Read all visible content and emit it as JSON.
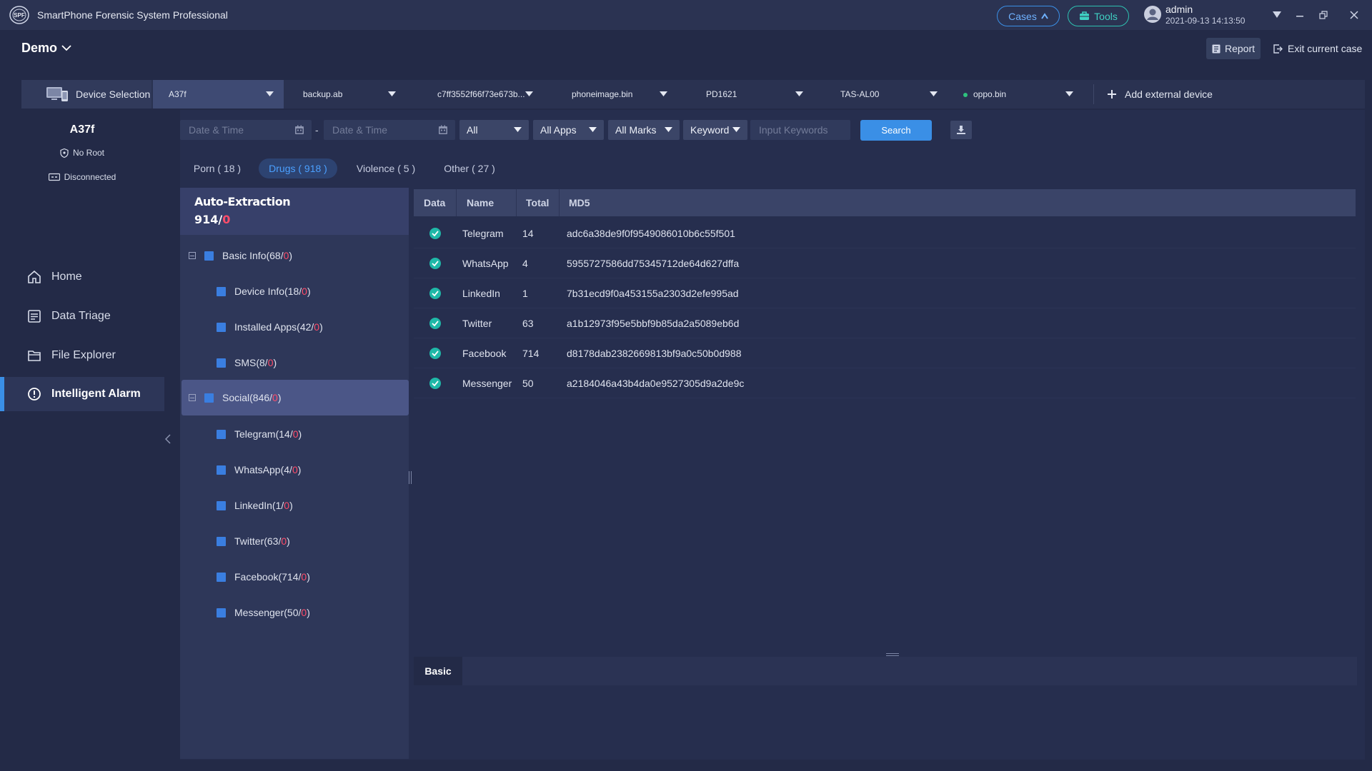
{
  "app": {
    "title": "SmartPhone Forensic System Professional",
    "logo_text": "SPF"
  },
  "header": {
    "cases_label": "Cases",
    "tools_label": "Tools",
    "user_name": "admin",
    "user_time": "2021-09-13 14:13:50"
  },
  "case": {
    "name": "Demo",
    "report_label": "Report",
    "exit_label": "Exit current case"
  },
  "devices": {
    "selection_label": "Device Selection",
    "tabs": [
      {
        "label": "A37f"
      },
      {
        "label": "backup.ab"
      },
      {
        "label": "c7ff3552f66f73e673b..."
      },
      {
        "label": "phoneimage.bin"
      },
      {
        "label": "PD1621"
      },
      {
        "label": "TAS-AL00"
      },
      {
        "label": "oppo.bin"
      }
    ],
    "add_external_label": "Add external device"
  },
  "sidebar": {
    "device_name": "A37f",
    "root_status": "No Root",
    "connection_status": "Disconnected",
    "nav": [
      {
        "label": "Home"
      },
      {
        "label": "Data Triage"
      },
      {
        "label": "File Explorer"
      },
      {
        "label": "Intelligent Alarm"
      }
    ]
  },
  "filters": {
    "date_start_placeholder": "Date & Time",
    "date_end_placeholder": "Date & Time",
    "dash": "-",
    "type_value": "All",
    "apps_value": "All Apps",
    "marks_value": "All Marks",
    "keyword_mode": "Keyword",
    "keyword_placeholder": "Input Keywords",
    "search_label": "Search"
  },
  "categories": [
    {
      "label": "Porn ( 18 )"
    },
    {
      "label": "Drugs ( 918 )"
    },
    {
      "label": "Violence ( 5 )"
    },
    {
      "label": "Other ( 27 )"
    }
  ],
  "tree": {
    "title": "Auto-Extraction",
    "count_main": "914/",
    "count_red": "0",
    "items": [
      {
        "label": "Basic Info(68/",
        "red": "0",
        "close": ")"
      },
      {
        "label": "Device Info(18/",
        "red": "0",
        "close": ")"
      },
      {
        "label": "Installed Apps(42/",
        "red": "0",
        "close": ")"
      },
      {
        "label": "SMS(8/",
        "red": "0",
        "close": ")"
      },
      {
        "label": "Social(846/",
        "red": "0",
        "close": ")"
      },
      {
        "label": "Telegram(14/",
        "red": "0",
        "close": ")"
      },
      {
        "label": "WhatsApp(4/",
        "red": "0",
        "close": ")"
      },
      {
        "label": "LinkedIn(1/",
        "red": "0",
        "close": ")"
      },
      {
        "label": "Twitter(63/",
        "red": "0",
        "close": ")"
      },
      {
        "label": "Facebook(714/",
        "red": "0",
        "close": ")"
      },
      {
        "label": "Messenger(50/",
        "red": "0",
        "close": ")"
      }
    ]
  },
  "table": {
    "columns": [
      "Data",
      "Name",
      "Total",
      "MD5"
    ],
    "rows": [
      {
        "name": "Telegram",
        "total": "14",
        "md5": "adc6a38de9f0f9549086010b6c55f501"
      },
      {
        "name": "WhatsApp",
        "total": "4",
        "md5": "5955727586dd75345712de64d627dffa"
      },
      {
        "name": "LinkedIn",
        "total": "1",
        "md5": "7b31ecd9f0a453155a2303d2efe995ad"
      },
      {
        "name": "Twitter",
        "total": "63",
        "md5": "a1b12973f95e5bbf9b85da2a5089eb6d"
      },
      {
        "name": "Facebook",
        "total": "714",
        "md5": "d8178dab2382669813bf9a0c50b0d988"
      },
      {
        "name": "Messenger",
        "total": "50",
        "md5": "a2184046a43b4da0e9527305d9a2de9c"
      }
    ]
  },
  "detail": {
    "tab_label": "Basic"
  },
  "colors": {
    "accent_blue": "#3a8fe6",
    "accent_teal": "#2ec0b0",
    "alert_red": "#ff4d6a",
    "background": "#232a47"
  }
}
